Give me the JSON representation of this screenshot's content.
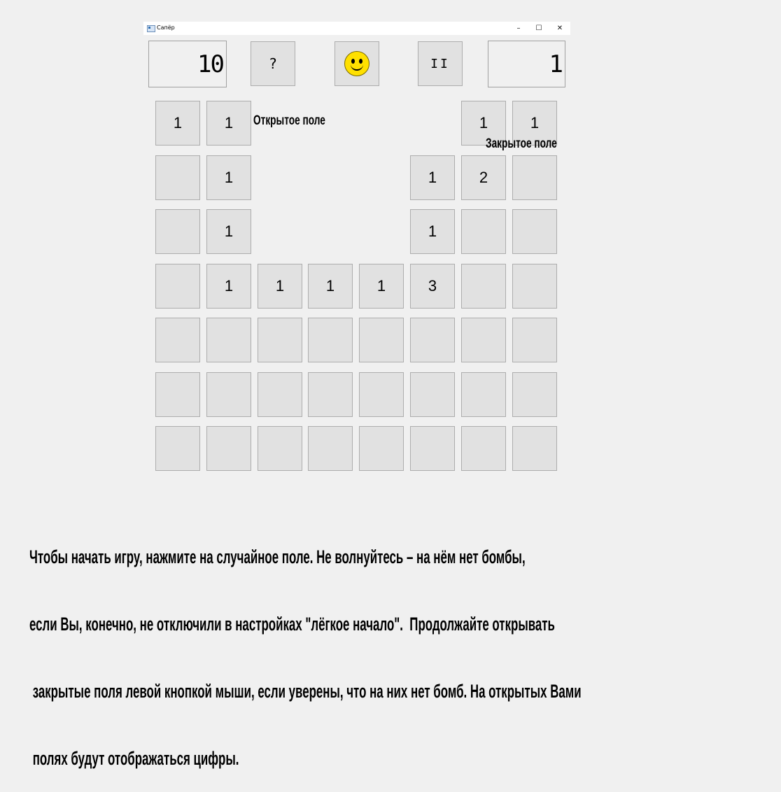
{
  "window": {
    "title": "Сапёр",
    "controls": {
      "minimize": "–",
      "maximize": "☐",
      "close": "✕"
    }
  },
  "toolbar": {
    "mines_counter": "10",
    "help_label": "?",
    "pause_label": "II",
    "timer": "1",
    "smiley_icon": "smiley-face-icon"
  },
  "board": {
    "rows": [
      [
        "1",
        "1",
        "",
        "",
        "",
        "",
        "1",
        "1"
      ],
      [
        "",
        "1",
        "",
        "",
        "",
        "1",
        "2",
        ""
      ],
      [
        "",
        "1",
        "",
        "",
        "",
        "1",
        "",
        ""
      ],
      [
        "",
        "1",
        "1",
        "1",
        "1",
        "3",
        "",
        ""
      ],
      [
        "",
        "",
        "",
        "",
        "",
        "",
        "",
        ""
      ],
      [
        "",
        "",
        "",
        "",
        "",
        "",
        "",
        ""
      ],
      [
        "",
        "",
        "",
        "",
        "",
        "",
        "",
        ""
      ]
    ],
    "revealed": [
      [
        false,
        false,
        true,
        true,
        true,
        true,
        false,
        false
      ],
      [
        false,
        false,
        true,
        true,
        true,
        false,
        false,
        false
      ],
      [
        false,
        false,
        true,
        true,
        true,
        false,
        false,
        false
      ],
      [
        false,
        false,
        false,
        false,
        false,
        false,
        false,
        false
      ],
      [
        false,
        false,
        false,
        false,
        false,
        false,
        false,
        false
      ],
      [
        false,
        false,
        false,
        false,
        false,
        false,
        false,
        false
      ],
      [
        false,
        false,
        false,
        false,
        false,
        false,
        false,
        false
      ]
    ]
  },
  "annotations": {
    "open_field": "Открытое поле",
    "closed_field": "Закрытое поле"
  },
  "description": {
    "lines": [
      "Чтобы начать игру, нажмите на случайное поле. Не волнуйтесь – на нём нет бомбы,",
      "если Вы, конечно, не отключили в настройках \"лёгкое начало\".  Продолжайте открывать",
      " закрытые поля левой кнопкой мыши, если уверены, что на них нет бомб. На открытых Вами",
      " полях будут отображаться цифры."
    ]
  }
}
